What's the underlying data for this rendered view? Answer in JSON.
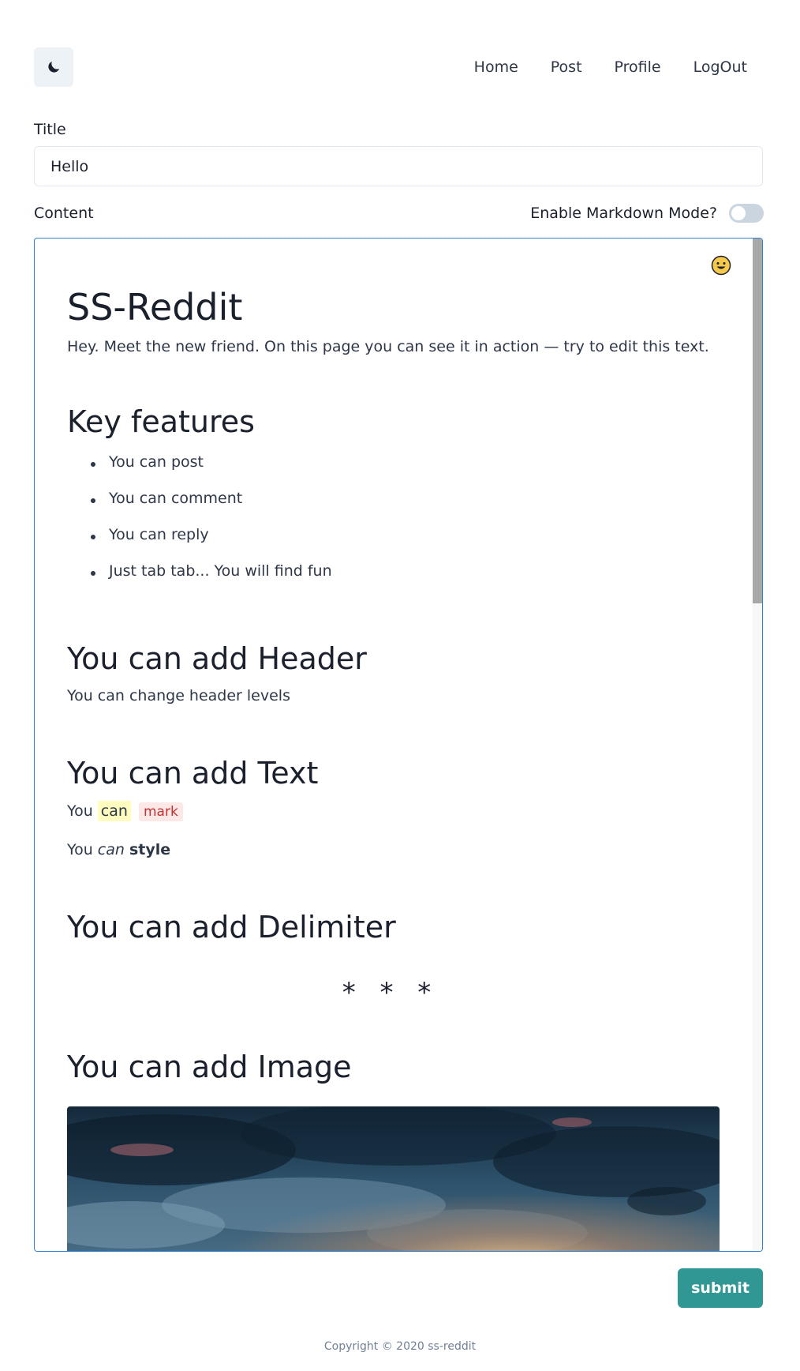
{
  "nav": {
    "theme_icon": "moon-icon",
    "links": [
      "Home",
      "Post",
      "Profile",
      "LogOut"
    ]
  },
  "form": {
    "title_label": "Title",
    "title_value": "Hello",
    "content_label": "Content",
    "markdown_label": "Enable Markdown Mode?",
    "markdown_enabled": false,
    "submit_label": "submit"
  },
  "editor": {
    "emoji_icon": "smile-emoji-icon",
    "heading": "SS-Reddit",
    "intro": "Hey. Meet the new friend. On this page you can see it in action — try to edit this text.",
    "features_heading": "Key features",
    "features": [
      "You can post",
      "You can comment",
      "You can reply",
      "Just tab tab... You will find fun"
    ],
    "header_heading": "You can add Header",
    "header_text": "You can change header levels",
    "text_heading": "You can add Text",
    "text_mark_prefix": "You",
    "text_mark_highlight": "can",
    "text_mark_code": "mark",
    "text_style_prefix": "You",
    "text_style_italic": "can",
    "text_style_bold": "style",
    "delimiter_heading": "You can add Delimiter",
    "delimiter": "* * *",
    "image_heading": "You can add Image"
  },
  "footer": {
    "copyright": "Copyright © 2020 ss-reddit"
  }
}
